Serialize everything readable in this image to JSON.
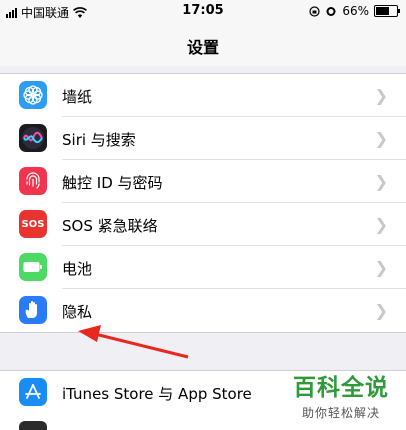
{
  "status_bar": {
    "carrier": "中国联通",
    "time": "17:05",
    "battery_percent": "66%",
    "battery_level": 0.66
  },
  "nav": {
    "title": "设置"
  },
  "settings_items": [
    {
      "label": "墙纸",
      "icon": "wallpaper-icon",
      "color": "#2d9cf5"
    },
    {
      "label": "Siri 与搜索",
      "icon": "siri-icon",
      "color": "#1c1c1e"
    },
    {
      "label": "触控 ID 与密码",
      "icon": "fingerprint-icon",
      "color": "#f2354f"
    },
    {
      "label": "SOS 紧急联络",
      "icon": "sos-icon",
      "color": "#e8332f",
      "icon_text": "SOS"
    },
    {
      "label": "电池",
      "icon": "battery-icon",
      "color": "#4cd964"
    },
    {
      "label": "隐私",
      "icon": "privacy-hand-icon",
      "color": "#2a7bf6"
    }
  ],
  "second_group": [
    {
      "label": "iTunes Store 与 App Store",
      "icon": "app-store-icon",
      "color": "#1a8cf5"
    }
  ],
  "watermark": {
    "main": "百科全说",
    "sub": "助你轻松解决"
  },
  "annotation": {
    "color": "#e8281e"
  }
}
